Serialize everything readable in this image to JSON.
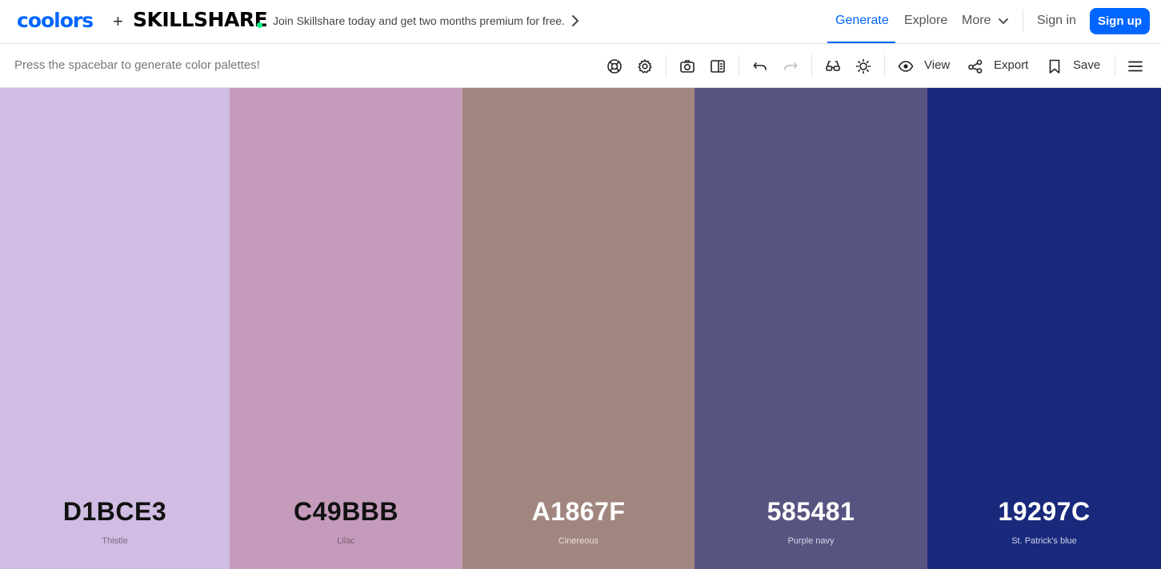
{
  "header": {
    "logo": "coolors",
    "plus": "+",
    "partner": "SKILLSHARE",
    "promo": "Join Skillshare today and get two months premium for free.",
    "nav": {
      "generate": "Generate",
      "explore": "Explore",
      "more": "More",
      "signin": "Sign in",
      "signup": "Sign up"
    },
    "accent": "#0066ff"
  },
  "toolbar": {
    "hint": "Press the spacebar to generate color palettes!",
    "view_label": "View",
    "export_label": "Export",
    "save_label": "Save",
    "icons": [
      "help-icon",
      "settings-icon",
      "camera-icon",
      "side-panel-icon",
      "undo-icon",
      "redo-icon",
      "glasses-icon",
      "brightness-icon",
      "eye-icon",
      "share-icon",
      "bookmark-icon",
      "menu-icon"
    ]
  },
  "palette": [
    {
      "hex": "D1BCE3",
      "name": "Thistle",
      "color": "#D1BCE3",
      "text_color": "#111111",
      "name_color": "#7a6a86"
    },
    {
      "hex": "C49BBB",
      "name": "Lilac",
      "color": "#C49BBB",
      "text_color": "#111111",
      "name_color": "#7b5f74"
    },
    {
      "hex": "A1867F",
      "name": "Cinereous",
      "color": "#A1867F",
      "text_color": "#ffffff",
      "name_color": "#e9dfdb"
    },
    {
      "hex": "585481",
      "name": "Purple navy",
      "color": "#585481",
      "text_color": "#ffffff",
      "name_color": "#d6d4e6"
    },
    {
      "hex": "19297C",
      "name": "St. Patrick's blue",
      "color": "#19297C",
      "text_color": "#ffffff",
      "name_color": "#cfd3ea"
    }
  ]
}
